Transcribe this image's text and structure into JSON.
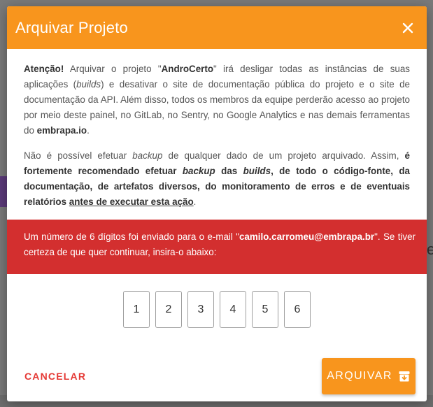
{
  "modal": {
    "title": "Arquivar Projeto",
    "close_icon": "close-icon",
    "paragraph1": {
      "attention": "Atenção!",
      "t1": " Arquivar o projeto \"",
      "project": "AndroCerto",
      "t2": "\" irá desligar todas as instâncias de suas aplicações (",
      "builds": "builds",
      "t3": ") e desativar o site de documentação pública do projeto e o site de documentação da API. Além disso, todos os membros da equipe perderão acesso ao projeto por meio deste painel, no GitLab, no Sentry, no Google Analytics e nas demais ferramentas do ",
      "site": "embrapa.io",
      "t4": "."
    },
    "paragraph2": {
      "t1": "Não é possível efetuar ",
      "backup": "backup",
      "t2": " de qualquer dado de um projeto arquivado. Assim, ",
      "b1": "é fortemente recomendado efetuar ",
      "b_backup": "backup",
      "b2": " das ",
      "b_builds": "builds",
      "b3": ", de todo o código-fonte, da documentação, de artefatos diversos, do monitoramento de erros e de eventuais relatórios",
      "t3": " ",
      "underline": "antes de executar esta ação",
      "t4": "."
    },
    "alert": {
      "t1": "Um número de 6 dígitos foi enviado para o e-mail \"",
      "email": "camilo.carromeu@embrapa.br",
      "t2": "\". Se tiver certeza de que quer continuar, insira-o abaixo:"
    },
    "digits": [
      "1",
      "2",
      "3",
      "4",
      "5",
      "6"
    ],
    "cancel_label": "CANCELAR",
    "archive_label": "ARQUIVAR",
    "archive_icon": "archive-box-icon"
  },
  "colors": {
    "header": "#f8951d",
    "alert": "#d32f2f",
    "cancel": "#e53935"
  }
}
